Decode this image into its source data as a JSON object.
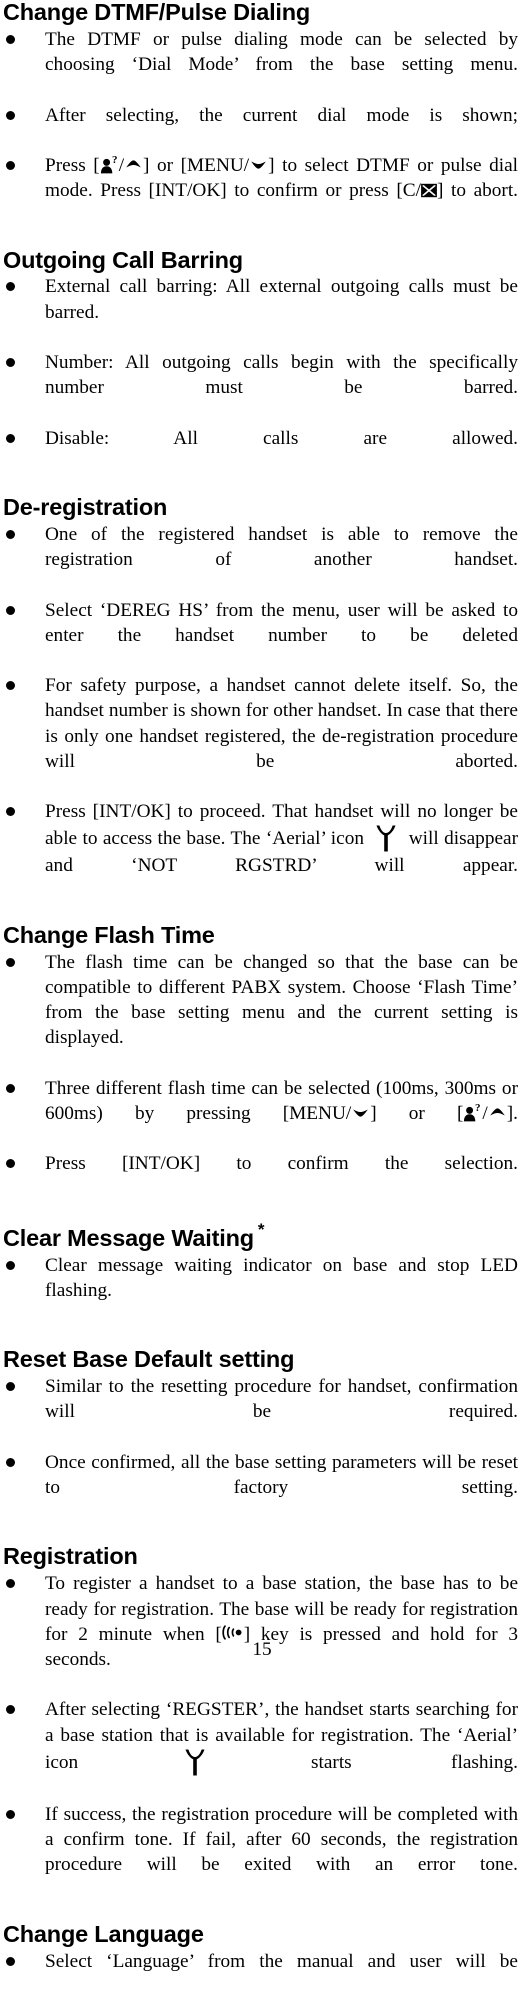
{
  "document": {
    "page_number": "15",
    "sections": [
      {
        "id": "change-dtmf-pulse-dialing",
        "heading": "Change DTMF/Pulse Dialing",
        "bullets": [
          {
            "id": "dtmf-b1",
            "parts": [
              {
                "t": "text",
                "v": "The DTMF or pulse dialing mode can be selected by choosing ‘Dial Mode’ from the base setting menu."
              }
            ]
          },
          {
            "id": "dtmf-b2",
            "parts": [
              {
                "t": "text",
                "v": "After selecting, the current dial mode is shown;"
              }
            ]
          },
          {
            "id": "dtmf-b3",
            "parts": [
              {
                "t": "text",
                "v": "Press ["
              },
              {
                "t": "icon",
                "v": "person-question-icon"
              },
              {
                "t": "text",
                "v": "/"
              },
              {
                "t": "icon",
                "v": "arrow-up-icon"
              },
              {
                "t": "text",
                "v": "]  or  [MENU/"
              },
              {
                "t": "icon",
                "v": "arrow-down-icon"
              },
              {
                "t": "text",
                "v": "] to select DTMF or pulse dial mode. Press [INT/OK] to confirm or press [C/"
              },
              {
                "t": "icon",
                "v": "crossed-box-icon"
              },
              {
                "t": "text",
                "v": "] to abort."
              }
            ]
          }
        ]
      },
      {
        "id": "outgoing-call-barring",
        "heading": "Outgoing Call Barring",
        "bullets": [
          {
            "id": "ocb-b1",
            "parts": [
              {
                "t": "text",
                "v": "External call barring: All external outgoing calls must be barred."
              }
            ]
          },
          {
            "id": "ocb-b2",
            "parts": [
              {
                "t": "text",
                "v": "Number: All outgoing calls begin with the specifically number must be barred."
              }
            ]
          },
          {
            "id": "ocb-b3",
            "parts": [
              {
                "t": "text",
                "v": "Disable: All calls are allowed."
              }
            ]
          }
        ]
      },
      {
        "id": "de-registration",
        "heading": "De-registration",
        "bullets": [
          {
            "id": "dereg-b1",
            "parts": [
              {
                "t": "text",
                "v": "One of the registered handset is able to remove the registration of another handset."
              }
            ]
          },
          {
            "id": "dereg-b2",
            "parts": [
              {
                "t": "text",
                "v": "Select ‘DEREG HS’ from the menu, user will be asked to enter the handset number to be deleted"
              }
            ]
          },
          {
            "id": "dereg-b3",
            "parts": [
              {
                "t": "text",
                "v": "For safety purpose, a handset cannot delete itself. So, the handset number is shown for other handset.  In case that there is only one handset registered, the de-registration procedure will be aborted."
              }
            ]
          },
          {
            "id": "dereg-b4",
            "parts": [
              {
                "t": "text",
                "v": "Press [INT/OK] to proceed. That handset will no longer be able to access the base. The ‘Aerial’ icon "
              },
              {
                "t": "icon",
                "v": "aerial-icon"
              },
              {
                "t": "text",
                "v": " will disappear and ‘NOT RGSTRD’ will appear."
              }
            ]
          }
        ]
      },
      {
        "id": "change-flash-time",
        "heading": "Change Flash Time",
        "bullets": [
          {
            "id": "flash-b1",
            "parts": [
              {
                "t": "text",
                "v": "The flash time can be changed so that the base can be compatible to different PABX system.   Choose ‘Flash Time’ from the base setting menu and the current setting is displayed."
              }
            ]
          },
          {
            "id": "flash-b2",
            "parts": [
              {
                "t": "text",
                "v": "Three different flash time can be selected (100ms, 300ms or 600ms) by pressing [MENU/"
              },
              {
                "t": "icon",
                "v": "arrow-down-icon"
              },
              {
                "t": "text",
                "v": "] or ["
              },
              {
                "t": "icon",
                "v": "person-question-icon"
              },
              {
                "t": "text",
                "v": "/"
              },
              {
                "t": "icon",
                "v": "arrow-up-icon"
              },
              {
                "t": "text",
                "v": "]."
              }
            ]
          },
          {
            "id": "flash-b3",
            "parts": [
              {
                "t": "text",
                "v": "Press [INT/OK] to confirm the selection."
              }
            ]
          }
        ]
      },
      {
        "id": "clear-message-waiting",
        "heading": "Clear Message Waiting",
        "heading_superscript": "*",
        "bullets": [
          {
            "id": "cmw-b1",
            "parts": [
              {
                "t": "text",
                "v": "Clear message waiting indicator on base and stop LED flashing."
              }
            ]
          }
        ]
      },
      {
        "id": "reset-base-default-setting",
        "heading": "Reset Base Default setting",
        "bullets": [
          {
            "id": "reset-b1",
            "parts": [
              {
                "t": "text",
                "v": "Similar to the resetting procedure for handset, confirmation will be required."
              }
            ]
          },
          {
            "id": "reset-b2",
            "parts": [
              {
                "t": "text",
                "v": "Once confirmed, all the base setting parameters will be reset to factory setting."
              }
            ]
          }
        ]
      },
      {
        "id": "registration",
        "heading": "Registration",
        "bullets": [
          {
            "id": "reg-b1",
            "parts": [
              {
                "t": "text",
                "v": "To register a handset to a base station, the base has to be ready for registration. The base will be ready for registration for 2 minute when ["
              },
              {
                "t": "icon",
                "v": "paging-icon"
              },
              {
                "t": "text",
                "v": "] key is pressed and hold for 3 seconds."
              }
            ]
          },
          {
            "id": "reg-b2",
            "parts": [
              {
                "t": "text",
                "v": "After selecting ‘REGSTER’, the handset starts searching for a base station that is available for registration. The ‘Aerial’ icon "
              },
              {
                "t": "icon",
                "v": "aerial-icon"
              },
              {
                "t": "text",
                "v": " starts flashing."
              }
            ]
          },
          {
            "id": "reg-b3",
            "parts": [
              {
                "t": "text",
                "v": "If success, the registration procedure will be completed with a confirm tone. If fail, after 60 seconds, the registration procedure will be exited with an error tone."
              }
            ]
          }
        ]
      },
      {
        "id": "change-language",
        "heading": "Change Language",
        "bullets": [
          {
            "id": "lang-b1",
            "parts": [
              {
                "t": "text",
                "v": "Select ‘Language’ from the manual and user will be"
              }
            ]
          }
        ]
      }
    ]
  },
  "colors": {
    "text": "#000000",
    "background": "#ffffff"
  }
}
